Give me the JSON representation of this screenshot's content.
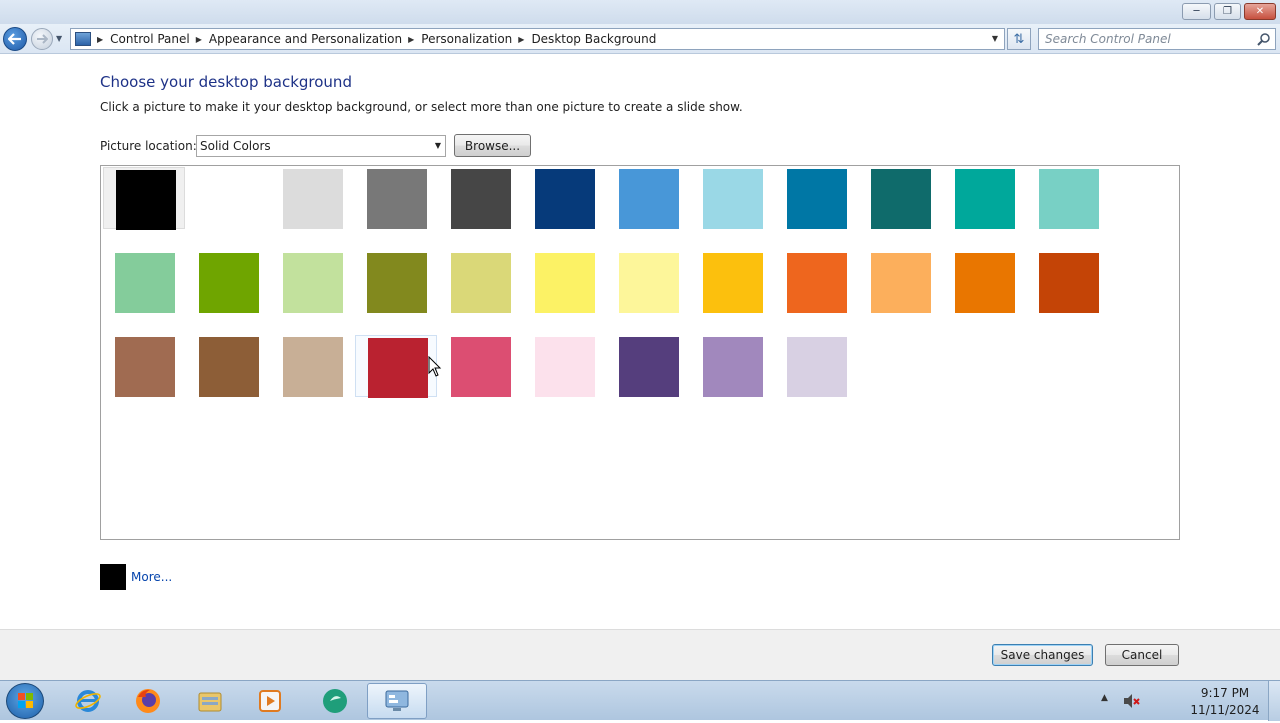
{
  "navigation": {
    "breadcrumbs": [
      "Control Panel",
      "Appearance and Personalization",
      "Personalization",
      "Desktop Background"
    ],
    "search_placeholder": "Search Control Panel"
  },
  "content": {
    "title": "Choose your desktop background",
    "subtitle": "Click a picture to make it your desktop background, or select more than one picture to create a slide show.",
    "location_label": "Picture location:",
    "location_value": "Solid Colors",
    "browse_label": "Browse...",
    "more_label": "More...",
    "preview_color": "#000000",
    "selected_index": 0,
    "hovered_index": 27
  },
  "swatches": [
    "#000000",
    "#ffffff",
    "#dcdcdc",
    "#787878",
    "#464646",
    "#063a7a",
    "#4897d8",
    "#9ad8e6",
    "#0077a5",
    "#0f6b6b",
    "#00a89b",
    "#78d0c5",
    "#84cc9b",
    "#6fa500",
    "#c2e19d",
    "#82891e",
    "#dad878",
    "#fcf265",
    "#fdf69a",
    "#fcc00d",
    "#ee661e",
    "#fcaf5c",
    "#e97600",
    "#c44406",
    "#a06b51",
    "#8d5e37",
    "#c8af96",
    "#ba2230",
    "#dc4e72",
    "#fce1ec",
    "#553e7d",
    "#a188bd",
    "#d8d0e3"
  ],
  "footer": {
    "save_label": "Save changes",
    "cancel_label": "Cancel"
  },
  "taskbar": {
    "items": [
      "start",
      "internet-explorer",
      "firefox",
      "file-explorer",
      "media-player",
      "app-green",
      "control-panel"
    ],
    "time": "9:17 PM",
    "date": "11/11/2024"
  }
}
